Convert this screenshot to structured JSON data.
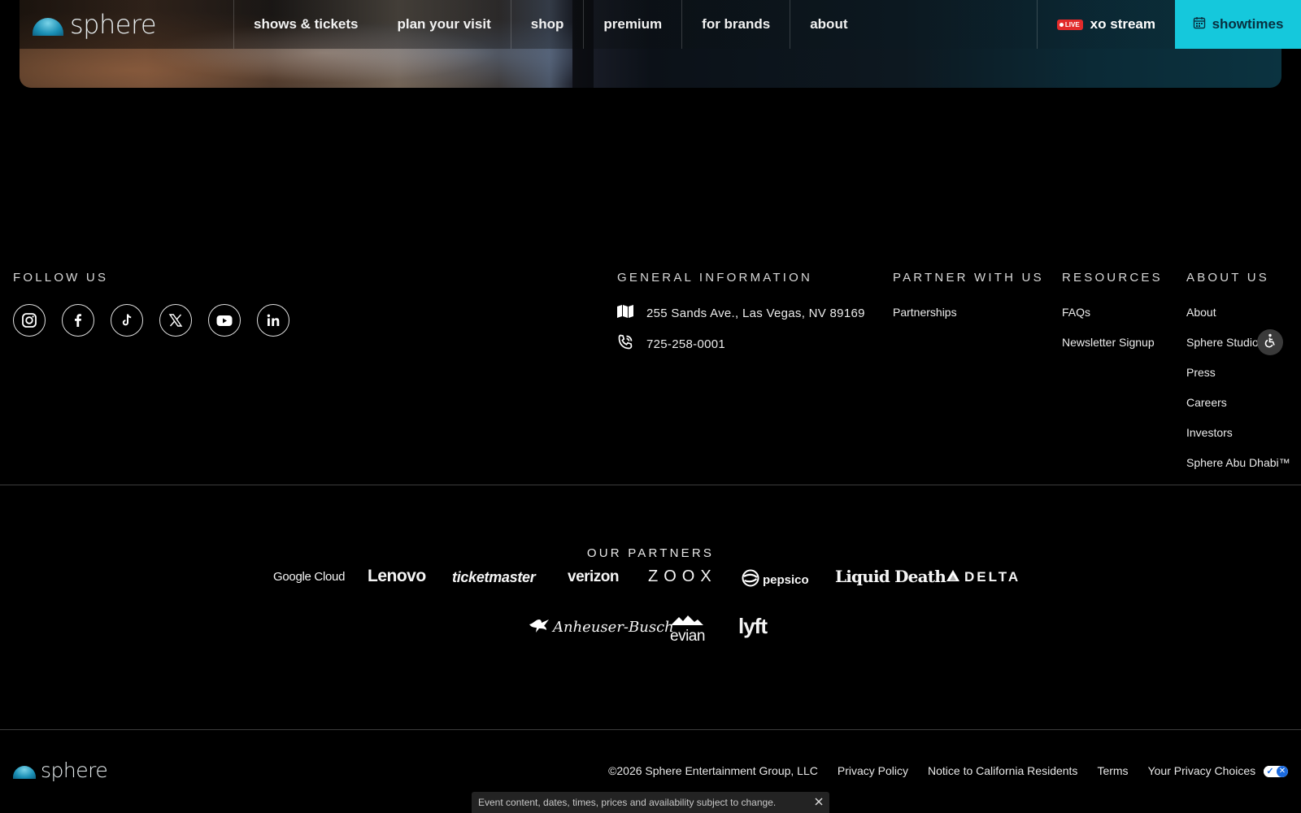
{
  "nav": {
    "logo_text": "sphere",
    "items": [
      "shows & tickets",
      "plan your visit",
      "shop",
      "premium",
      "for brands",
      "about"
    ],
    "live_label": "LIVE",
    "xo_label": "xo stream",
    "showtimes_label": "showtimes"
  },
  "follow": {
    "title": "FOLLOW US",
    "icons": [
      "instagram-icon",
      "facebook-icon",
      "tiktok-icon",
      "x-icon",
      "youtube-icon",
      "linkedin-icon"
    ]
  },
  "general": {
    "title": "GENERAL INFORMATION",
    "address": "255 Sands Ave., Las Vegas, NV 89169",
    "phone": "725-258-0001"
  },
  "partner": {
    "title": "PARTNER WITH US",
    "links": [
      "Partnerships"
    ]
  },
  "resources": {
    "title": "RESOURCES",
    "links": [
      "FAQs",
      "Newsletter Signup"
    ]
  },
  "about_us": {
    "title": "ABOUT US",
    "links": [
      "About",
      "Sphere Studios",
      "Press",
      "Careers",
      "Investors",
      "Sphere Abu Dhabi™"
    ]
  },
  "partners": {
    "title": "OUR PARTNERS",
    "logos": [
      "Google Cloud",
      "Lenovo",
      "ticketmaster",
      "verizon",
      "ZOOX",
      "pepsico",
      "Liquid Death",
      "DELTA",
      "Anheuser-Busch",
      "evian",
      "lyft"
    ]
  },
  "footer": {
    "logo_text": "sphere",
    "copyright": "©2026 Sphere Entertainment Group, LLC",
    "privacy_policy": "Privacy Policy",
    "california": "Notice to California Residents",
    "terms": "Terms",
    "privacy_choices": "Your Privacy Choices"
  },
  "notice": {
    "text": "Event content, dates, times, prices and availability subject to change."
  },
  "colors": {
    "accent": "#15c8dc",
    "live": "#e22b2b",
    "background": "#000000"
  }
}
